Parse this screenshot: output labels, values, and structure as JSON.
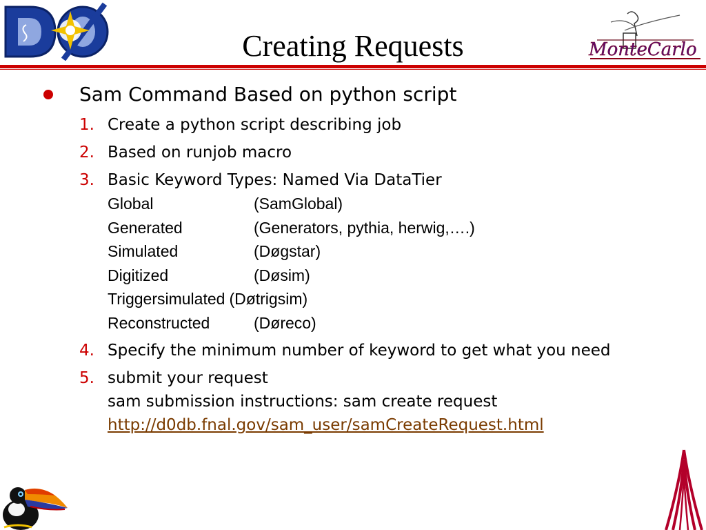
{
  "slide": {
    "title": "Creating Requests",
    "bullet": "Sam Command Based on python script",
    "items": [
      {
        "num": "1.",
        "text": "Create a python script describing job"
      },
      {
        "num": "2.",
        "text": "Based on runjob macro"
      },
      {
        "num": "3.",
        "text": "Basic Keyword Types: Named Via DataTier"
      },
      {
        "num": "4.",
        "text": "Specify the minimum number of keyword to get what you need"
      },
      {
        "num": "5.",
        "text": "submit your request",
        "subtext": "sam submission instructions: sam create request",
        "link": "http://d0db.fnal.gov/sam_user/samCreateRequest.html"
      }
    ],
    "keywords": [
      {
        "name": "Global",
        "value": "(SamGlobal)"
      },
      {
        "name": "Generated",
        "value": "(Generators, pythia, herwig,….)"
      },
      {
        "name": "Simulated",
        "value": "(Døgstar)"
      },
      {
        "name": "Digitized",
        "value": "(Døsim)"
      },
      {
        "name": "Triggersimulated",
        "value": "(Døtrigsim)"
      },
      {
        "name": "Reconstructed",
        "value": "(Døreco)"
      }
    ]
  },
  "colors": {
    "accent": "#cc0000",
    "link": "#7a3b00",
    "d0_logo_blue": "#1a3c9c",
    "d0_logo_yellow": "#f2c200"
  },
  "icons": [
    "d0-logo",
    "monte-carlo-logo",
    "toucan-image",
    "fermilab-arch-image"
  ]
}
